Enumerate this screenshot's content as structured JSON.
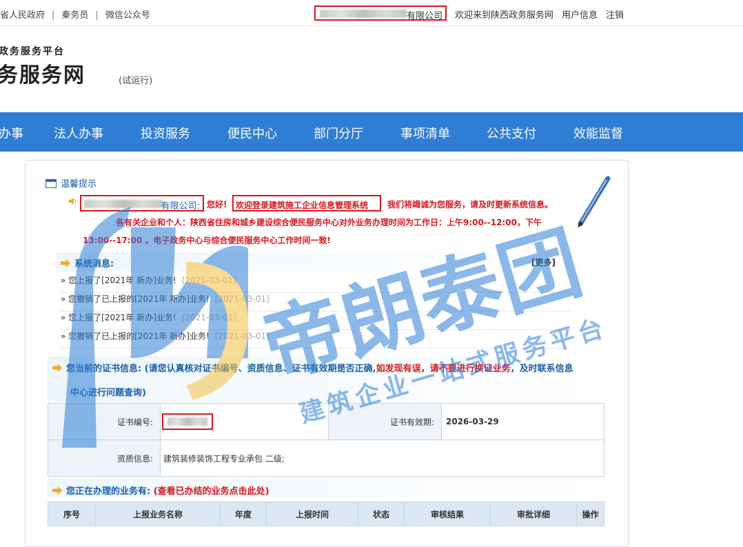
{
  "top": {
    "links": [
      "省人民政府",
      "秦务员",
      "微信公众号"
    ],
    "company_suffix": "有限公司",
    "welcome": "欢迎来到陕西政务服务网",
    "user_info": "用户信息",
    "logout": "注销"
  },
  "brand": {
    "line1": "政务服务平台",
    "line2": "务服务网",
    "trial": "(试运行)"
  },
  "nav": [
    "办事",
    "法人办事",
    "投资服务",
    "便民中心",
    "部门分厅",
    "事项清单",
    "公共支付",
    "效能监督"
  ],
  "tip": {
    "title": "温馨提示",
    "company_suffix": "有限公司:",
    "hello": "您好!",
    "welcome": "欢迎登录建筑施工企业信息管理系统",
    "promise": "我们将竭诚为您服务，请及时更新系统信息。",
    "notice_line1": "各有关企业和个人：陕西省住房和城乡建设综合便民服务中心对外业务办理时间为工作日：上午9:00--12:00，下午",
    "notice_line2": "13:00--17:00 。电子政务中心与综合便民服务中心工作时间一致!"
  },
  "system": {
    "title": "系统消息:",
    "more": "[更多]",
    "messages": [
      {
        "text": "» 您上报了[2021年 新办]业务!",
        "date": "[2021-03-01]"
      },
      {
        "text": "» 您撤销了已上报的[2021年 新办]业务!",
        "date": "[2021-03-01]"
      },
      {
        "text": "» 您上报了[2021年 新办]业务!",
        "date": "[2021-03-01]"
      },
      {
        "text": "» 您撤销了已上报的[2021年 新办]业务!",
        "date": "[2021-03-01]"
      }
    ]
  },
  "cert": {
    "title": "您当前的证书信息:",
    "hint_a": "(请您认真核对证书编号、资质信息、证书有效期是否正确,",
    "hint_red": "如发现有误，请不要进行换证业务",
    "hint_b": "，及时联系信息",
    "hint_line2": "中心进行问题查询)",
    "no_label": "证书编号:",
    "valid_label": "证书有效期:",
    "valid_value": "2026-03-29",
    "qual_label": "资质信息:",
    "qual_value": "建筑装修装饰工程专业承包 二级;"
  },
  "business": {
    "title": "您正在办理的业务有:",
    "link": "(查看已办结的业务点击此处)",
    "columns": [
      "序号",
      "上报业务名称",
      "年度",
      "上报时间",
      "状态",
      "审核结果",
      "审批详细",
      "操作"
    ]
  },
  "watermark": {
    "big": "帝朗泰团",
    "small": "建筑企业一站式服务平台"
  },
  "colors": {
    "nav_bg": "#2e7ed6",
    "alert_red": "#d9161c",
    "link_blue": "#1a5fa8",
    "accent_orange": "#f5a623"
  }
}
